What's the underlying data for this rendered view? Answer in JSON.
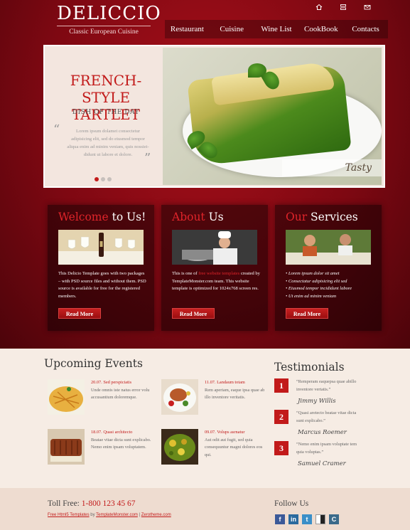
{
  "brand": {
    "title": "DELICCIO",
    "subtitle": "Classic European Cuisine"
  },
  "top_icons": [
    "home-icon",
    "sitemap-icon",
    "mail-icon"
  ],
  "nav": {
    "items": [
      "Restaurant",
      "Cuisine",
      "Wine List",
      "CookBook",
      "Contacts"
    ]
  },
  "hero": {
    "title_line1": "FRENCH-STYLE",
    "title_line2": "TARTLET",
    "subtitle": "DISH OF THE DAY",
    "quote_open": "“",
    "quote_close": "”",
    "quote": "Lorem ipsum dolamet consectetur adipisicing elit, sed do eiusmod tempor aliqua enim ad minim veniam, quis nossiei- didunt ut labore et dolore.",
    "badge": "Tasty",
    "slides": 3,
    "active_slide": 1
  },
  "boxes": [
    {
      "title_hl": "Welcome",
      "title_rest": " to Us!",
      "text": "This Delicio Template goes with two packages – with PSD source files and without them. PSD source is available for free for the registered members.",
      "button": "Read More"
    },
    {
      "title_hl": "About",
      "title_rest": " Us",
      "text_a": "This is one of ",
      "text_link": "free website templates",
      "text_b": " created by TemplateMonster.com team. This website template is optimized for 1024x768 screen res.",
      "button": "Read More"
    },
    {
      "title_hl": "Our",
      "title_rest": " Services",
      "list": [
        "Lorem ipsum dolor sit amet",
        "Consectatur adipisicing elit sed",
        "Eiusmod tempor incididunt labore",
        "Ut enim ad minim veniam"
      ],
      "button": "Read More"
    }
  ],
  "events": {
    "title": "Upcoming Events",
    "items": [
      {
        "head": "20.07. Sed perspiciatis",
        "text": "Unde omnis iste natus error volu accusantium doloremque."
      },
      {
        "head": "11.07. Landaum totam",
        "text": "Rem aperiam, eaque ipsa quae ab illo inventore veritatis."
      },
      {
        "head": "18.07. Quasi architecto",
        "text": "Beatae vitae dicta sunt explicabo. Nemo enim ipsam voluptatem."
      },
      {
        "head": "09.07. Volups asrnatur",
        "text": "Aut odit aut fugit, sed quia consequuntur magni dolores eos qui."
      }
    ]
  },
  "testimonials": {
    "title": "Testimonials",
    "items": [
      {
        "num": "1",
        "text": "“Remperam eaquepsa quae abillo inventore vertatis.”",
        "sig": "Jimmy Willis"
      },
      {
        "num": "2",
        "text": "“Quasi aretecto beatae vitae dicta sunt explicabo.”",
        "sig": "Marcus Roemer"
      },
      {
        "num": "3",
        "text": "“Nemo enim ipsam voluptate tem quia voluptas.”",
        "sig": "Samuel Cramer"
      }
    ]
  },
  "footer": {
    "toll_label": "Toll Free: ",
    "toll_number": "1-800 123 45 67",
    "credit_link1": "Free Html5 Templates",
    "credit_by": " by ",
    "credit_link2": "TemplateMonster.com",
    "credit_sep": " | ",
    "credit_link3": "Zerotheme.com",
    "follow": "Follow Us",
    "socials": [
      {
        "name": "facebook-icon",
        "glyph": "f",
        "color": "#3b5998"
      },
      {
        "name": "linkedin-icon",
        "glyph": "in",
        "color": "#2a6a9e"
      },
      {
        "name": "twitter-icon",
        "glyph": "t",
        "color": "#3a8fc8"
      },
      {
        "name": "delicious-icon",
        "glyph": "",
        "color": "#888888"
      },
      {
        "name": "technorati-icon",
        "glyph": "C",
        "color": "#3a6a8a"
      }
    ]
  }
}
